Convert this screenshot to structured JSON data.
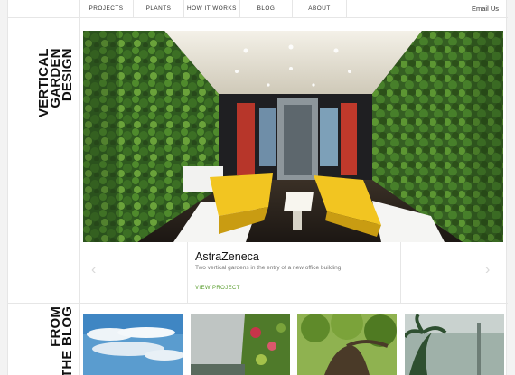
{
  "nav": {
    "items": [
      "PROJECTS",
      "PLANTS",
      "HOW IT WORKS",
      "BLOG",
      "ABOUT"
    ],
    "email": "Email Us"
  },
  "side": {
    "brand_lines": [
      "VERTICAL",
      "GARDEN",
      "DESIGN"
    ],
    "blog_lines": [
      "FROM",
      "THE BLOG"
    ]
  },
  "project": {
    "title": "AstraZeneca",
    "description": "Two vertical gardens in the entry of a new office building.",
    "link": "VIEW PROJECT"
  },
  "arrows": {
    "prev": "‹",
    "next": "›"
  },
  "colors": {
    "accent": "#5a9e2f",
    "sofa": "#f2c521",
    "foliage": "#3e6b27"
  },
  "blog": {
    "thumbnails": [
      "sky-clouds",
      "green-wall-building",
      "tree-canopy",
      "palm-forest"
    ]
  }
}
